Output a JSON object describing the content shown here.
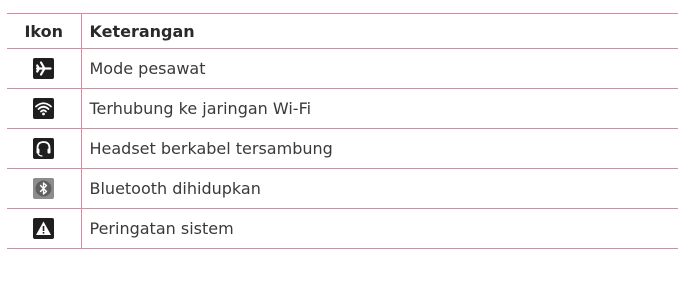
{
  "table": {
    "header": {
      "icon": "Ikon",
      "description": "Keterangan"
    },
    "rows": [
      {
        "icon": "airplane-icon",
        "label": "Mode pesawat"
      },
      {
        "icon": "wifi-icon",
        "label": "Terhubung ke jaringan Wi-Fi"
      },
      {
        "icon": "headset-icon",
        "label": "Headset berkabel tersambung"
      },
      {
        "icon": "bluetooth-icon",
        "label": "Bluetooth dihidupkan"
      },
      {
        "icon": "warning-icon",
        "label": "Peringatan sistem"
      }
    ]
  },
  "colors": {
    "rule": "#d98a9c",
    "icon_dark": "#1e1e1e",
    "icon_grey": "#8c8c8c"
  }
}
